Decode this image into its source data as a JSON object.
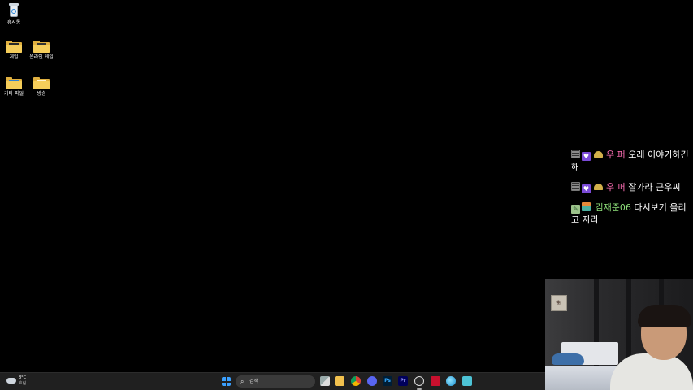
{
  "desktop": {
    "icons": [
      {
        "label": "휴지통"
      },
      {
        "label": "게임"
      },
      {
        "label": "온라인 게임"
      },
      {
        "label": "기타 파일"
      },
      {
        "label": "방송"
      }
    ]
  },
  "chat": {
    "messages": [
      {
        "nick": "우 퍼",
        "text": "오래 이야기하긴해"
      },
      {
        "nick": "우 퍼",
        "text": "잘가라 근우씨"
      },
      {
        "nick": "김재준06",
        "text": "다시보기 올리고 자라"
      }
    ]
  },
  "taskbar": {
    "weather_temp": "8°C",
    "weather_desc": "흐림",
    "search_placeholder": "검색",
    "apps": [
      {
        "icon": "task-view-icon"
      },
      {
        "icon": "file-explorer-icon"
      },
      {
        "icon": "chrome-icon"
      },
      {
        "icon": "discord-icon"
      },
      {
        "icon": "photoshop-icon",
        "glyph": "Ps"
      },
      {
        "icon": "premiere-icon",
        "glyph": "Pr"
      },
      {
        "icon": "obs-icon"
      },
      {
        "icon": "red-app-icon"
      },
      {
        "icon": "globe-icon"
      },
      {
        "icon": "notepad-icon"
      }
    ]
  },
  "colors": {
    "nick_pink": "#ff6fb5",
    "nick_green": "#8ee07a",
    "folder": "#f5cd5a",
    "taskbar": "#202020"
  }
}
